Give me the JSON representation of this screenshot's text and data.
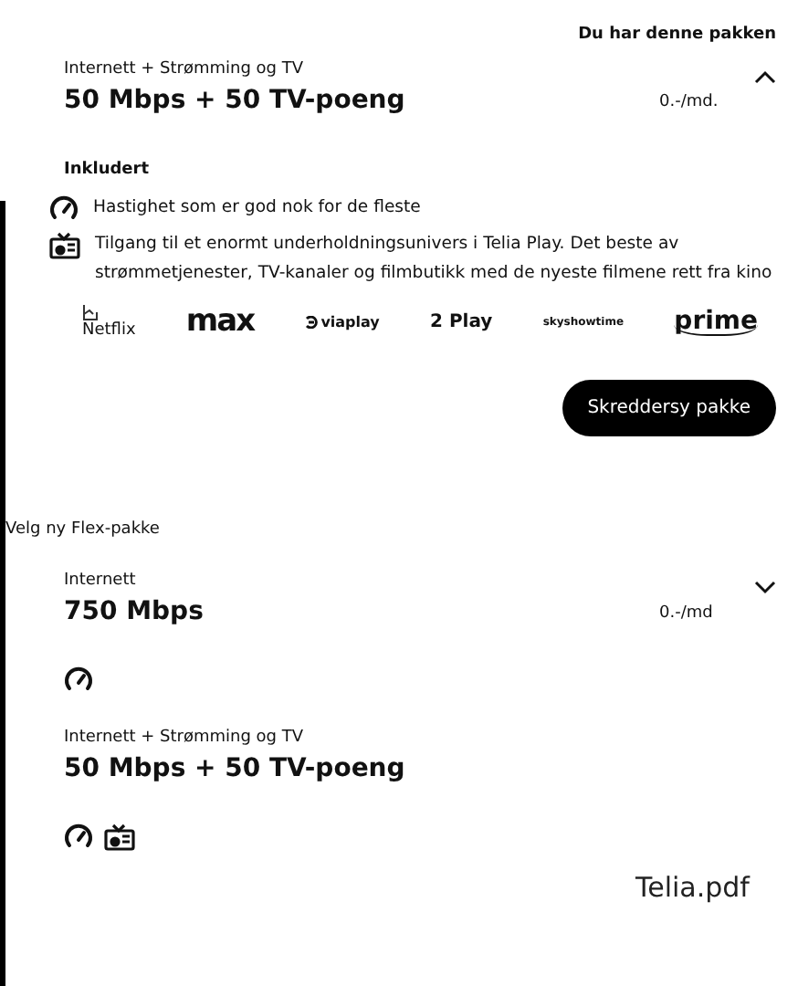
{
  "current_badge": "Du har denne pakken",
  "current": {
    "category": "Internett + Strømming og TV",
    "name": "50 Mbps + 50 TV-poeng",
    "price": "0.-/md.",
    "expanded": true,
    "included_heading": "Inkludert",
    "features": [
      {
        "kind": "speed",
        "text": "Hastighet som er god nok for de fleste"
      },
      {
        "kind": "tv",
        "text": "Tilgang til et enormt underholdningsunivers i Telia Play. Det beste av strømmetjenester, TV-kanaler og filmbutikk med de nyeste filmene rett fra kino"
      }
    ],
    "services": [
      {
        "kind": "broken",
        "text": "Netflix"
      },
      {
        "kind": "max",
        "text": "max"
      },
      {
        "kind": "viaplay",
        "text": "viaplay"
      },
      {
        "kind": "twoplay",
        "text": "2 Play"
      },
      {
        "kind": "sky",
        "text": "skyshowtime"
      },
      {
        "kind": "prime",
        "text": "prime"
      }
    ],
    "button": "Skreddersy pakke"
  },
  "choose_heading": "Velg ny Flex-pakke",
  "options": [
    {
      "category": "Internett",
      "name": "750 Mbps",
      "price": "0.-/md",
      "expanded": false,
      "icons": [
        {
          "kind": "speed"
        }
      ]
    },
    {
      "category": "Internett + Strømming og TV",
      "name": "50 Mbps + 50 TV-poeng",
      "icons": [
        {
          "kind": "speed"
        },
        {
          "kind": "tv"
        }
      ]
    }
  ],
  "file_label": "Telia.pdf"
}
